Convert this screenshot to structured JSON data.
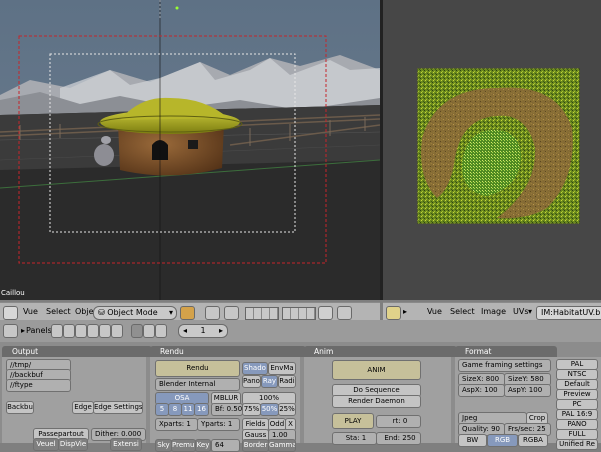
{
  "viewport": {
    "status_text": "Caillou"
  },
  "view3d_header": {
    "menus": [
      "Vue",
      "Select",
      "Object"
    ],
    "mode_select": "Object Mode"
  },
  "image_header": {
    "menus": [
      "Vue",
      "Select",
      "Image",
      "UVs"
    ],
    "image_name": "IM:HabitatUV.b"
  },
  "panels_bar": {
    "label": "Panels",
    "page_value": "1"
  },
  "output_panel": {
    "title": "Output",
    "paths": [
      "//tmp/",
      "//backbuf",
      "//ftype"
    ],
    "backbuf": "Backbu",
    "edge": "Edge",
    "edge_settings": "Edge Settings",
    "passepartout": "Passepartout",
    "dither": "Dither: 0.000",
    "row_bottom": [
      "Veuel",
      "DispVie",
      "Extensi"
    ]
  },
  "rendu_panel": {
    "title": "Rendu",
    "render_button": "Rendu",
    "renderer": "Blender Internal",
    "shadow": "Shado",
    "envmap": "EnvMa",
    "pano": "Pano",
    "ray": "Ray",
    "radio": "Radi",
    "osa": "OSA",
    "osa_levels": [
      "5",
      "8",
      "11",
      "16"
    ],
    "mblur": "MBLUR",
    "bf": "Bf: 0.50",
    "percent_100": "100%",
    "percents": [
      "75%",
      "50%",
      "25%"
    ],
    "xparts": "Xparts: 1",
    "yparts": "Yparts: 1",
    "fields": "Fields",
    "odd": "Odd",
    "x": "X",
    "gauss": "Gauss",
    "gauss_value": "1.00",
    "bottom_row": [
      "Sky",
      "Premul",
      "Key",
      "64",
      "Border",
      "Gamma"
    ]
  },
  "anim_panel": {
    "title": "Anim",
    "anim_button": "ANIM",
    "do_sequence": "Do Sequence",
    "render_daemon": "Render Daemon",
    "play": "PLAY",
    "rt": "rt: 0",
    "sta": "Sta: 1",
    "end": "End: 250"
  },
  "format_panel": {
    "title": "Format",
    "framing": "Game framing settings",
    "sizex": "SizeX: 800",
    "sizey": "SizeY: 580",
    "aspx": "AspX: 100",
    "aspy": "AspY: 100",
    "file_format": "Jpeg",
    "crop": "Crop",
    "quality": "Quality: 90",
    "fps": "Frs/sec: 25",
    "color_modes": [
      "BW",
      "RGB",
      "RGBA"
    ],
    "presets": [
      "PAL",
      "NTSC",
      "Default",
      "Preview",
      "PC",
      "PAL 16:9",
      "PANO",
      "FULL",
      "Unified Re"
    ]
  }
}
